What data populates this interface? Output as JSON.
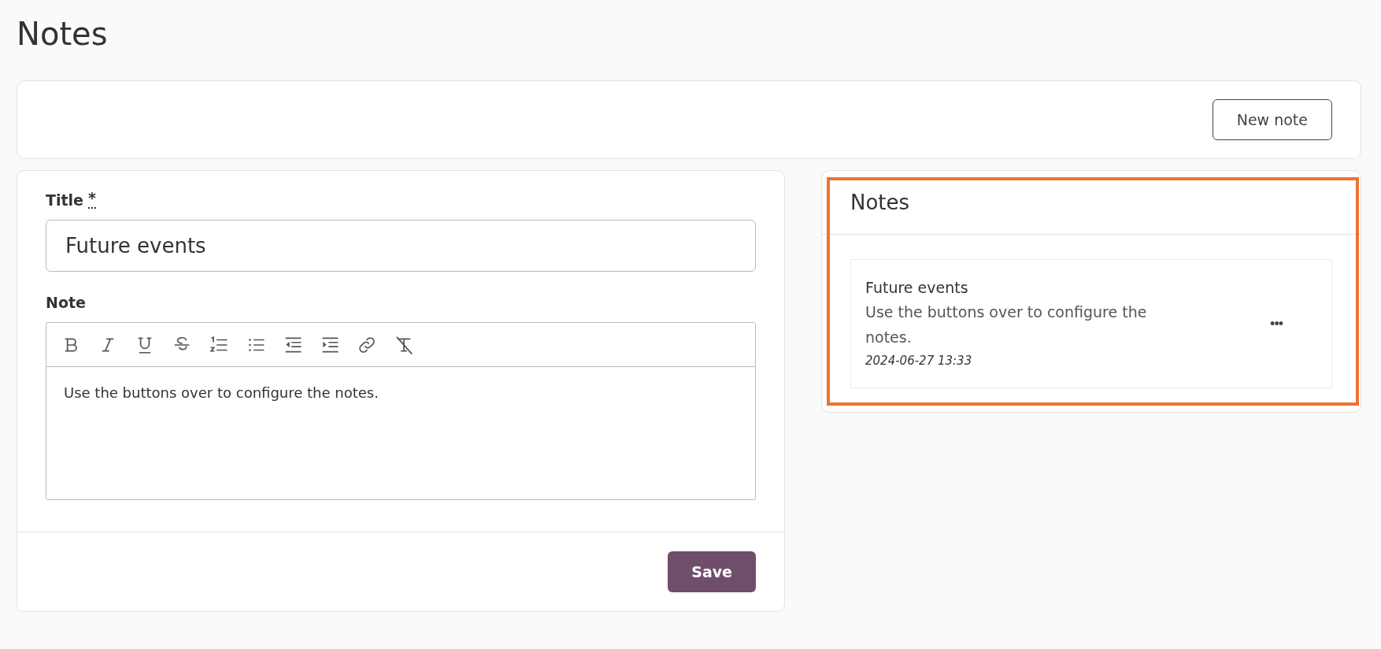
{
  "page_title": "Notes",
  "toolbar": {
    "new_note_button": "New note"
  },
  "form": {
    "title_label": "Title",
    "required_mark": "*",
    "title_value": "Future events",
    "note_label": "Note",
    "editor_tools": [
      {
        "kind": "bold"
      },
      {
        "kind": "italic"
      },
      {
        "kind": "underline"
      },
      {
        "kind": "strike"
      },
      {
        "kind": "ordered-list"
      },
      {
        "kind": "bullet-list"
      },
      {
        "kind": "outdent"
      },
      {
        "kind": "indent"
      },
      {
        "kind": "link"
      },
      {
        "kind": "clear-format"
      }
    ],
    "note_text": "Use the buttons over to configure the notes.",
    "save_button": "Save"
  },
  "notes_panel": {
    "title": "Notes",
    "highlighted": true,
    "items": [
      {
        "title": "Future events",
        "text": "Use the buttons over to configure the notes.",
        "timestamp": "2024-06-27 13:33",
        "more": "•••"
      }
    ]
  }
}
